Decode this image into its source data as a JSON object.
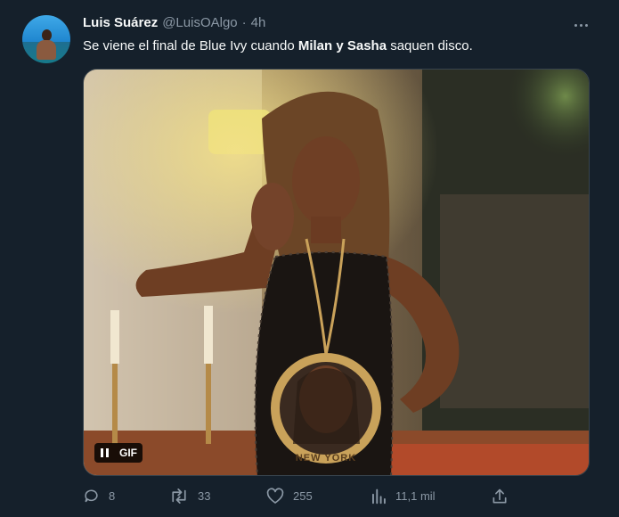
{
  "tweet": {
    "author_name": "Luis Suárez",
    "handle": "@LuisOAlgo",
    "separator": "·",
    "time": "4h",
    "text_parts": [
      "Se viene el final de Blue Ivy cuando ",
      "Milan y Sasha",
      " saquen disco."
    ],
    "media": {
      "badge": "GIF",
      "pendant_text": "NEW YORK"
    }
  },
  "actions": {
    "replies": "8",
    "retweets": "33",
    "likes": "255",
    "views": "11,1 mil"
  },
  "colors": {
    "background": "#15202b",
    "text": "#f7f9f9",
    "secondary": "#8b98a5",
    "border": "#38444d"
  },
  "icons": [
    "avatar",
    "more-icon",
    "pause-icon",
    "reply-icon",
    "retweet-icon",
    "like-icon",
    "views-icon",
    "share-icon"
  ]
}
